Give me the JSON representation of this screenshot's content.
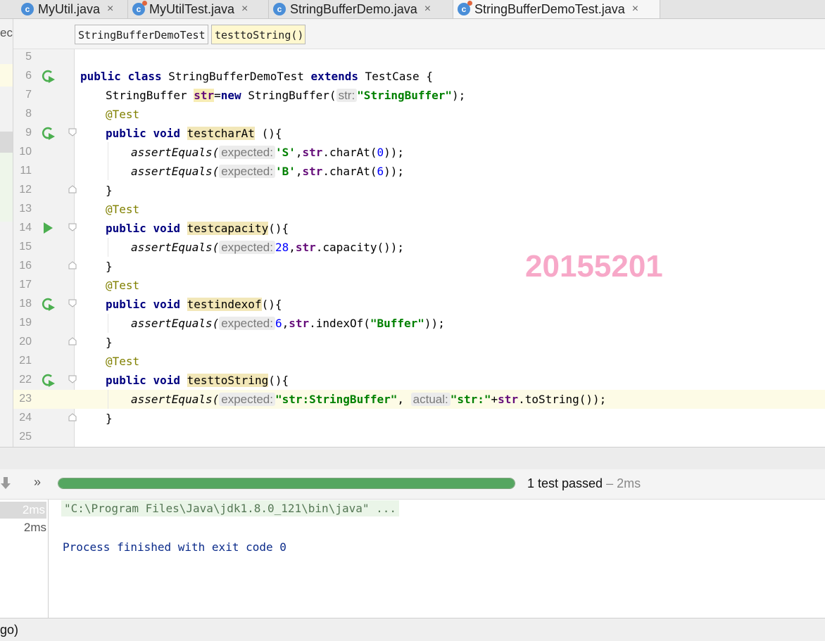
{
  "tabs": [
    {
      "label": "MyUtil.java",
      "close": "×",
      "test": false
    },
    {
      "label": "MyUtilTest.java",
      "close": "×",
      "test": true
    },
    {
      "label": "StringBufferDemo.java",
      "close": "×",
      "test": false
    },
    {
      "label": "StringBufferDemoTest.java",
      "close": "×",
      "test": true,
      "active": true
    }
  ],
  "left_fragment": "ec",
  "breadcrumb": [
    "StringBufferDemoTest",
    "testtoString()"
  ],
  "line_numbers": [
    "5",
    "6",
    "7",
    "8",
    "9",
    "10",
    "11",
    "12",
    "13",
    "14",
    "15",
    "16",
    "17",
    "18",
    "19",
    "20",
    "21",
    "22",
    "23",
    "24",
    "25"
  ],
  "code": {
    "l6": {
      "kw1": "public",
      "kw2": "class",
      "name": "StringBufferDemoTest",
      "kw3": "extends",
      "parent": "TestCase",
      "tail": "{"
    },
    "l7": {
      "type": "StringBuffer",
      "field": "str",
      "eq": "=",
      "kw": "new",
      "ctor": "StringBuffer(",
      "hint": "str:",
      "str": "\"StringBuffer\"",
      "tail": ");"
    },
    "l8": "@Test",
    "l9": {
      "kw1": "public",
      "kw2": "void",
      "name": "testcharAt",
      "tail": " (){"
    },
    "l10": {
      "call": "assertEquals(",
      "hint": "expected:",
      "str": "'S'",
      "comma": ",",
      "field": "str",
      "rest1": ".charAt(",
      "num": "0",
      "rest2": "));"
    },
    "l11": {
      "call": "assertEquals(",
      "hint": "expected:",
      "str": "'B'",
      "comma": ",",
      "field": "str",
      "rest1": ".charAt(",
      "num": "6",
      "rest2": "));"
    },
    "l12": "}",
    "l13": "@Test",
    "l14": {
      "kw1": "public",
      "kw2": "void",
      "name": "testcapacity",
      "tail": "(){"
    },
    "l15": {
      "call": "assertEquals(",
      "hint": "expected:",
      "num": "28",
      "comma": ",",
      "field": "str",
      "rest": ".capacity());"
    },
    "l16": "}",
    "l17": "@Test",
    "l18": {
      "kw1": "public",
      "kw2": "void",
      "name": "testindexof",
      "tail": "(){"
    },
    "l19": {
      "call": "assertEquals(",
      "hint": "expected:",
      "num": "6",
      "comma": ",",
      "field": "str",
      "rest1": ".indexOf(",
      "str": "\"Buffer\"",
      "rest2": "));"
    },
    "l20": "}",
    "l21": "@Test",
    "l22": {
      "kw1": "public",
      "kw2": "void",
      "name": "testtoString",
      "tail": "(){"
    },
    "l23": {
      "call": "assertEquals(",
      "hint": "expected:",
      "str": "\"str:StringBuffer\"",
      "comma": ",",
      "hint2": "actual:",
      "str2": "\"str:\"",
      "plus": "+",
      "field": "str",
      "rest": ".toString());"
    },
    "l24": "}"
  },
  "watermark": "20155201",
  "runner": {
    "forward": "»",
    "progress": 1.0,
    "passed": "1 test passed",
    "time_sep": " – 2ms",
    "times": [
      "2ms",
      "2ms"
    ]
  },
  "console": {
    "cmd": "\"C:\\Program Files\\Java\\jdk1.8.0_121\\bin\\java\" ...",
    "result": "Process finished with exit code 0"
  },
  "statusbar": "go)",
  "colors": {
    "run_green": "#4caf50",
    "progress_green": "#55a660",
    "watermark": "#f7a8c8"
  }
}
